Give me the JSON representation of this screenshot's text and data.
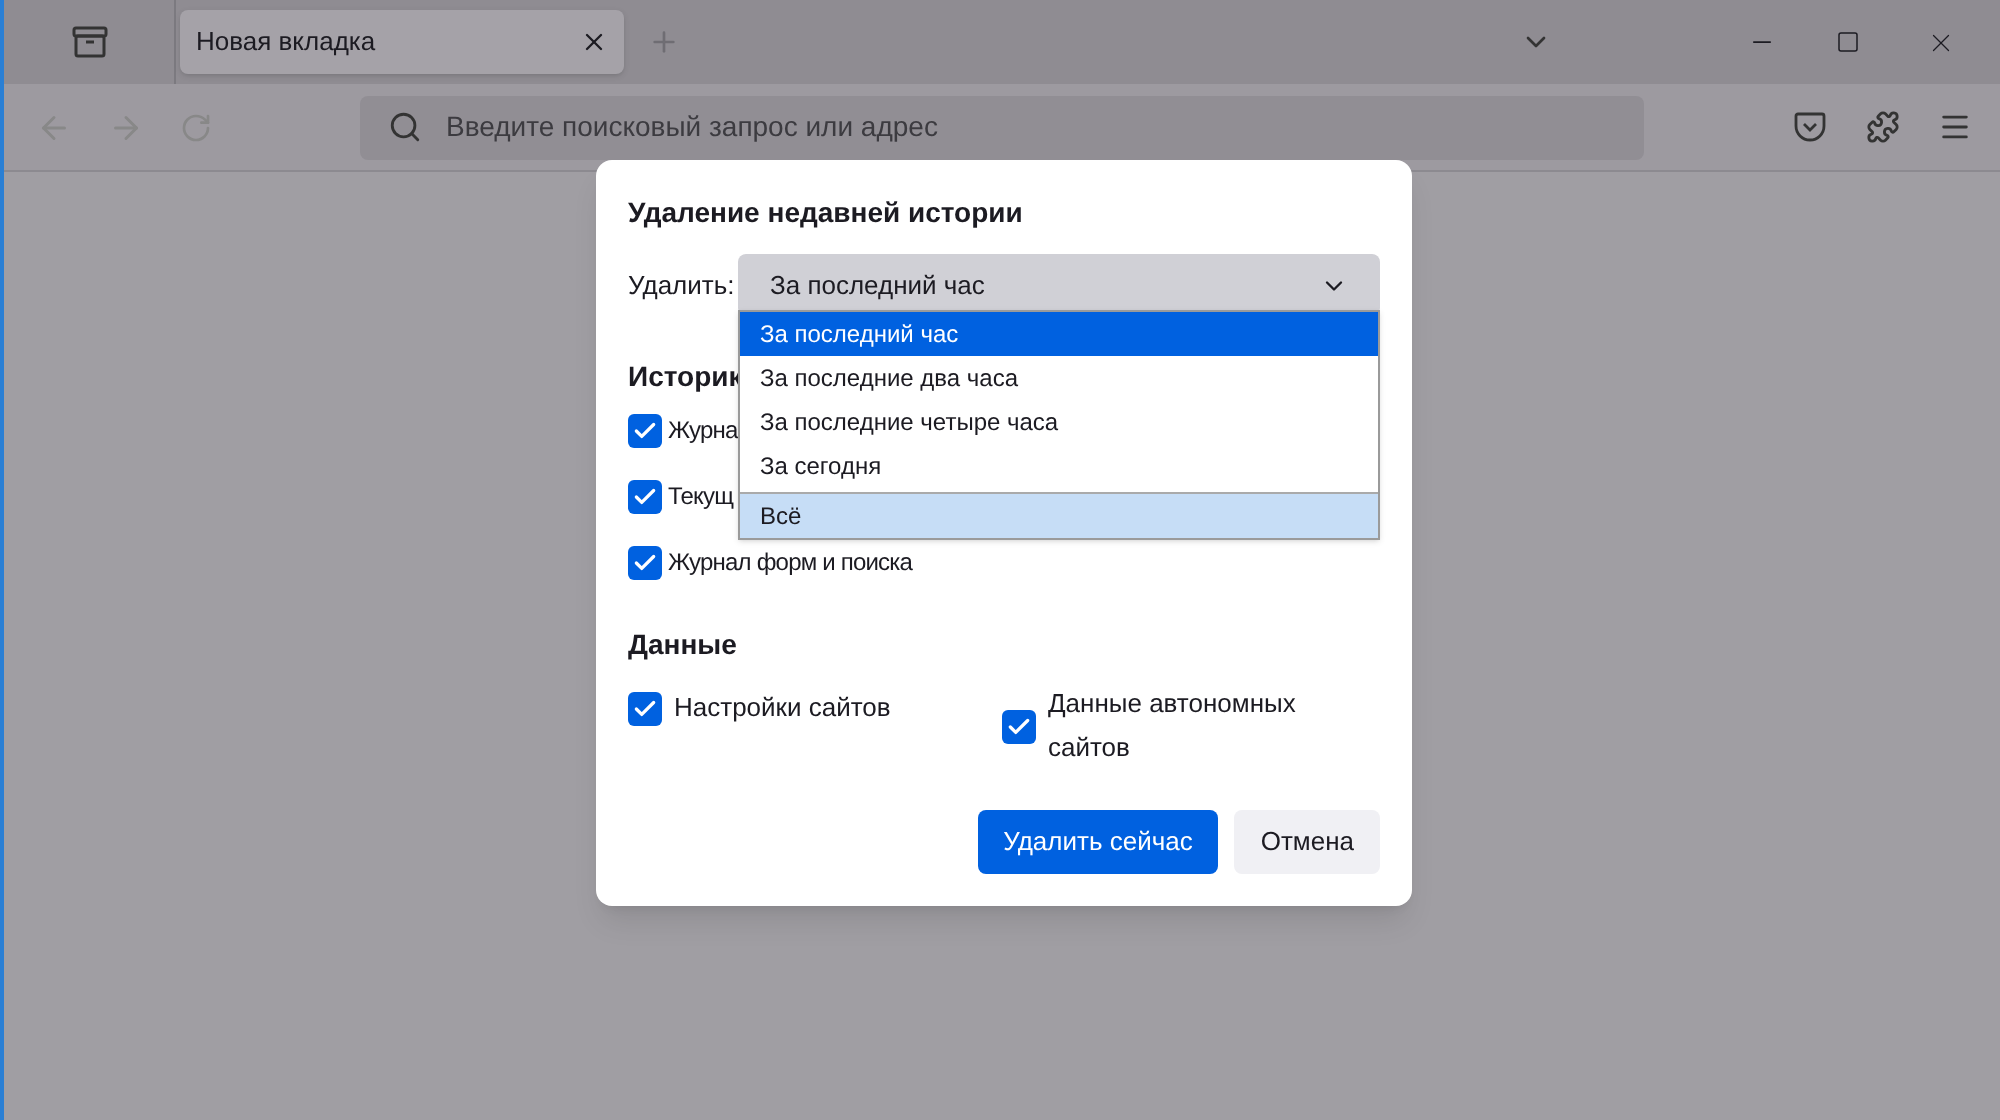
{
  "tabs": [
    {
      "label": "Новая вкладка",
      "selected": true
    }
  ],
  "address_bar": {
    "placeholder": "Введите поисковый запрос или адрес"
  },
  "dialog": {
    "title": "Удаление недавней истории",
    "range_label": "Удалить:",
    "range_value": "За последний час",
    "range_options": [
      {
        "label": "За последний час",
        "selected": true
      },
      {
        "label": "За последние два часа",
        "selected": false
      },
      {
        "label": "За последние четыре часа",
        "selected": false
      },
      {
        "label": "За сегодня",
        "selected": false
      },
      {
        "label": "Всё",
        "selected": false
      }
    ],
    "history_heading": "Историк",
    "history_items": [
      {
        "label": "Журна",
        "checked": true
      },
      {
        "label": "Текущ",
        "checked": true
      },
      {
        "label": "Журнал форм и поиска",
        "checked": true
      }
    ],
    "data_heading": "Данные",
    "data_items": [
      {
        "label": "Настройки сайтов",
        "checked": true
      },
      {
        "label": "Данные автономных сайтов",
        "checked": true
      }
    ],
    "buttons": [
      {
        "label": "Удалить сейчас",
        "kind": "primary"
      },
      {
        "label": "Отмена",
        "kind": "secondary"
      }
    ]
  }
}
